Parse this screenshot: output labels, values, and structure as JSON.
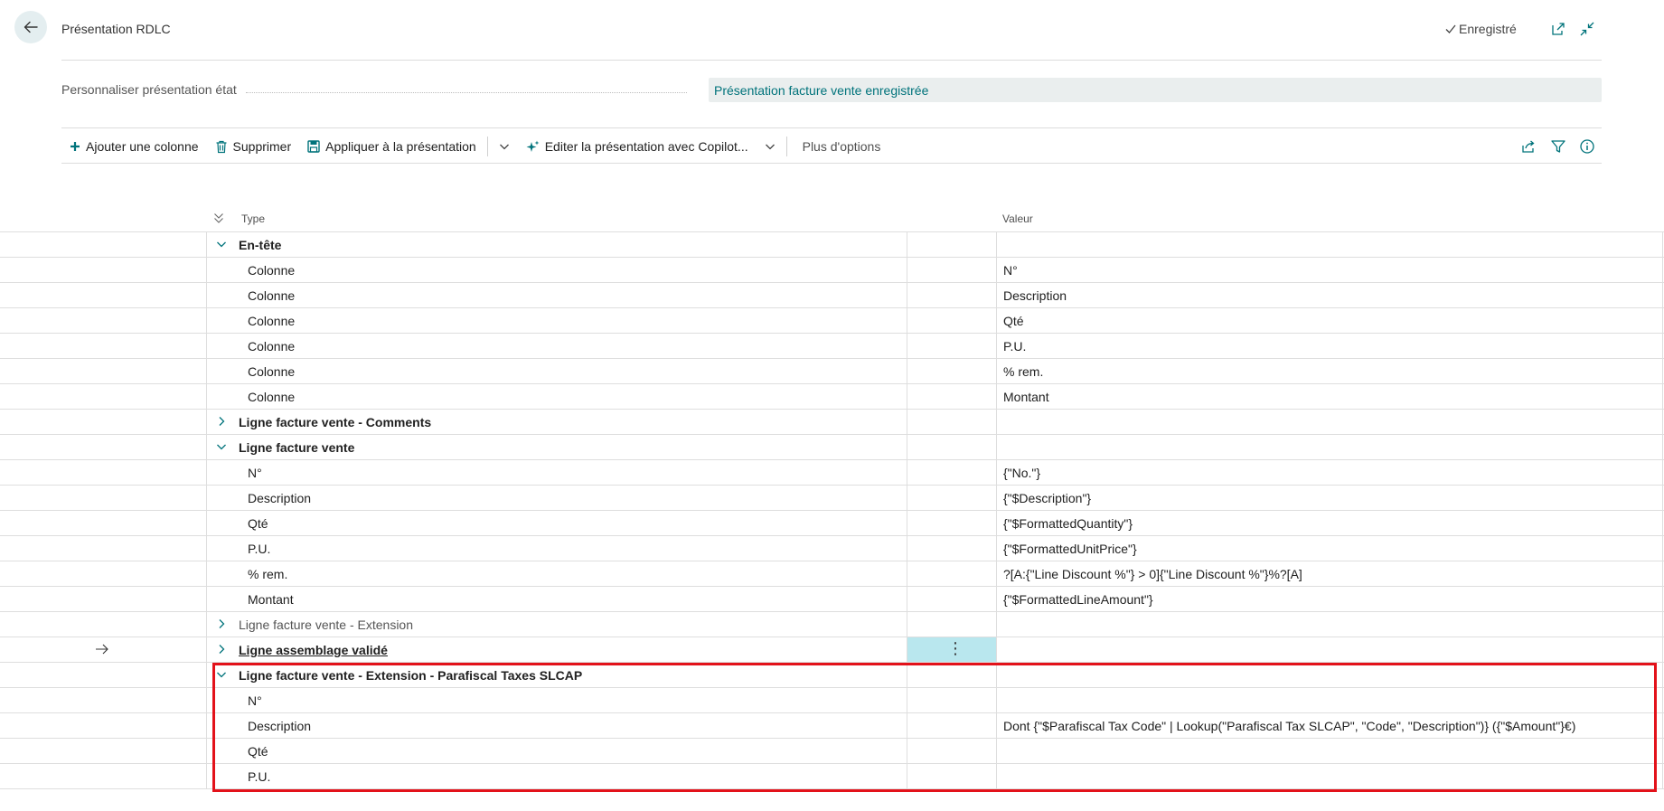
{
  "header": {
    "title": "Présentation RDLC",
    "saved_status": "Enregistré"
  },
  "field": {
    "label": "Personnaliser présentation état",
    "value": "Présentation facture vente enregistrée"
  },
  "actions": {
    "add_column": "Ajouter une colonne",
    "delete": "Supprimer",
    "apply": "Appliquer à la présentation",
    "edit_copilot": "Editer la présentation avec Copilot...",
    "more_options": "Plus d'options"
  },
  "grid": {
    "col_type": "Type",
    "col_value": "Valeur",
    "rows": [
      {
        "type": "En-tête",
        "value": ""
      },
      {
        "type": "Colonne",
        "value": "N°"
      },
      {
        "type": "Colonne",
        "value": "Description"
      },
      {
        "type": "Colonne",
        "value": "Qté"
      },
      {
        "type": "Colonne",
        "value": "P.U."
      },
      {
        "type": "Colonne",
        "value": "% rem."
      },
      {
        "type": "Colonne",
        "value": "Montant"
      },
      {
        "type": "Ligne facture vente - Comments",
        "value": ""
      },
      {
        "type": "Ligne facture vente",
        "value": ""
      },
      {
        "type": "N°",
        "value": "{\"No.\"}"
      },
      {
        "type": "Description",
        "value": "{\"$Description\"}"
      },
      {
        "type": "Qté",
        "value": "{\"$FormattedQuantity\"}"
      },
      {
        "type": "P.U.",
        "value": "{\"$FormattedUnitPrice\"}"
      },
      {
        "type": "% rem.",
        "value": "?[A:{\"Line Discount %\"} > 0]{\"Line Discount %\"}%?[A]"
      },
      {
        "type": "Montant",
        "value": "{\"$FormattedLineAmount\"}"
      },
      {
        "type": "Ligne facture vente - Extension",
        "value": ""
      },
      {
        "type": "Ligne assemblage validé",
        "value": ""
      },
      {
        "type": "Ligne facture vente - Extension - Parafiscal Taxes SLCAP",
        "value": ""
      },
      {
        "type": "N°",
        "value": ""
      },
      {
        "type": "Description",
        "value": "Dont {\"$Parafiscal Tax Code\" | Lookup(\"Parafiscal Tax SLCAP\", \"Code\", \"Description\")} ({\"$Amount\"}€)"
      },
      {
        "type": "Qté",
        "value": ""
      },
      {
        "type": "P.U.",
        "value": ""
      }
    ]
  }
}
